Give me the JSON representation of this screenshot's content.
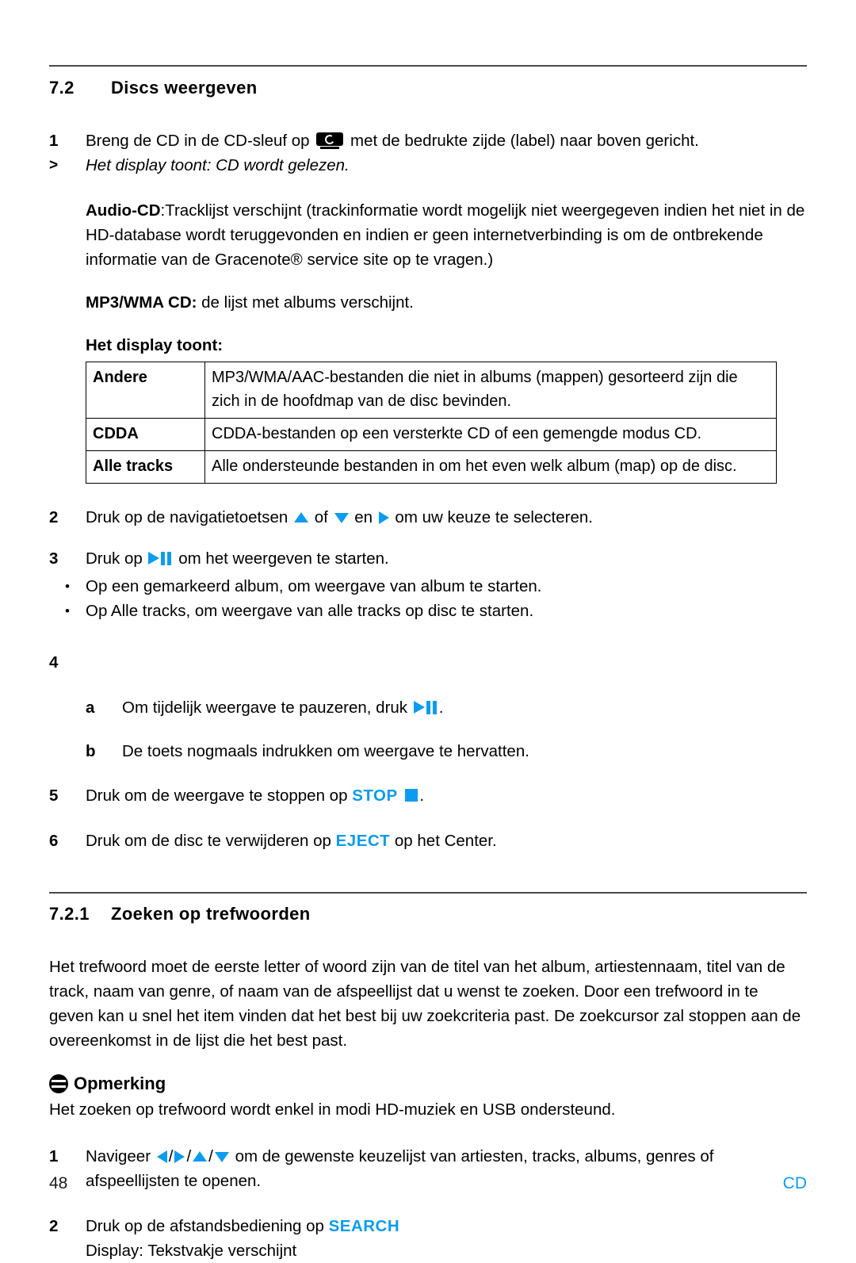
{
  "colors": {
    "accent": "#0b9cf0",
    "text": "#000000",
    "rule": "#4a4a4a"
  },
  "section": {
    "number": "7.2",
    "title": "Discs weergeven"
  },
  "steps": {
    "s1": {
      "marker": "1",
      "text_before": "Breng de CD in de CD-sleuf op",
      "text_after": "met de bedrukte zijde (label) naar boven gericht."
    },
    "result1": {
      "marker": ">",
      "text": "Het display toont: CD wordt gelezen."
    },
    "audio_cd": {
      "label": "Audio-CD",
      "text": ":Tracklijst verschijnt (trackinformatie wordt mogelijk niet weergegeven indien het niet in de HD-database wordt teruggevonden en indien er geen internetverbinding is om de ontbrekende informatie van de Gracenote® service site op te vragen.)"
    },
    "mp3_cd": {
      "label": "MP3/WMA CD:",
      "text": " de lijst met albums verschijnt."
    },
    "display_heading": "Het display toont:",
    "s2": {
      "marker": "2",
      "part1": "Druk op de navigatietoetsen",
      "part2": "of",
      "part3": "en",
      "part4": "om uw keuze te selecteren."
    },
    "s3": {
      "marker": "3",
      "part1": "Druk op",
      "part2": "om het weergeven te starten."
    },
    "bullets": [
      "Op een gemarkeerd album, om weergave van album te starten.",
      "Op Alle tracks, om weergave van alle tracks op disc te starten."
    ],
    "s4": {
      "marker": "4",
      "text": ""
    },
    "s4a": {
      "marker": "a",
      "part1": "Om tijdelijk weergave te pauzeren, druk",
      "part2": "."
    },
    "s4b": {
      "marker": "b",
      "text": "De toets nogmaals indrukken om weergave te hervatten."
    },
    "s5": {
      "marker": "5",
      "part1": "Druk om de weergave te stoppen op",
      "label": "STOP",
      "part2": "."
    },
    "s6": {
      "marker": "6",
      "part1": "Druk om de disc te verwijderen op",
      "label": "EJECT",
      "part2": "op het Center."
    }
  },
  "table": {
    "rows": [
      {
        "key": "Andere",
        "value": "MP3/WMA/AAC-bestanden die niet in albums (mappen) gesorteerd zijn die zich in de hoofdmap van de disc bevinden."
      },
      {
        "key": "CDDA",
        "value": "CDDA-bestanden op een versterkte CD of een gemengde modus CD."
      },
      {
        "key": "Alle tracks",
        "value": "Alle ondersteunde bestanden in om het even welk album (map) op de disc."
      }
    ]
  },
  "subsection": {
    "number": "7.2.1",
    "title": "Zoeken op trefwoorden",
    "paragraph": "Het trefwoord moet de eerste letter of woord zijn van de titel van het album, artiestennaam, titel van de track, naam van genre, of naam van de afspeellijst dat u wenst te zoeken. Door een trefwoord in te geven kan u snel het item vinden dat het best bij uw zoekcriteria past. De zoekcursor zal stoppen aan de overeenkomst in de lijst die het best past.",
    "note": {
      "title": "Opmerking",
      "text": "Het zoeken op trefwoord wordt enkel in modi HD-muziek en USB ondersteund."
    },
    "n1": {
      "marker": "1",
      "part1": "Navigeer",
      "sep": "/",
      "part2": "om de gewenste keuzelijst van artiesten, tracks, albums, genres of afspeellijsten te openen."
    },
    "n2": {
      "marker": "2",
      "part1": "Druk op de afstandsbediening op",
      "label": "SEARCH",
      "line2": "Display: Tekstvakje verschijnt"
    }
  },
  "footer": {
    "page_number": "48",
    "doc_tag": "CD"
  }
}
